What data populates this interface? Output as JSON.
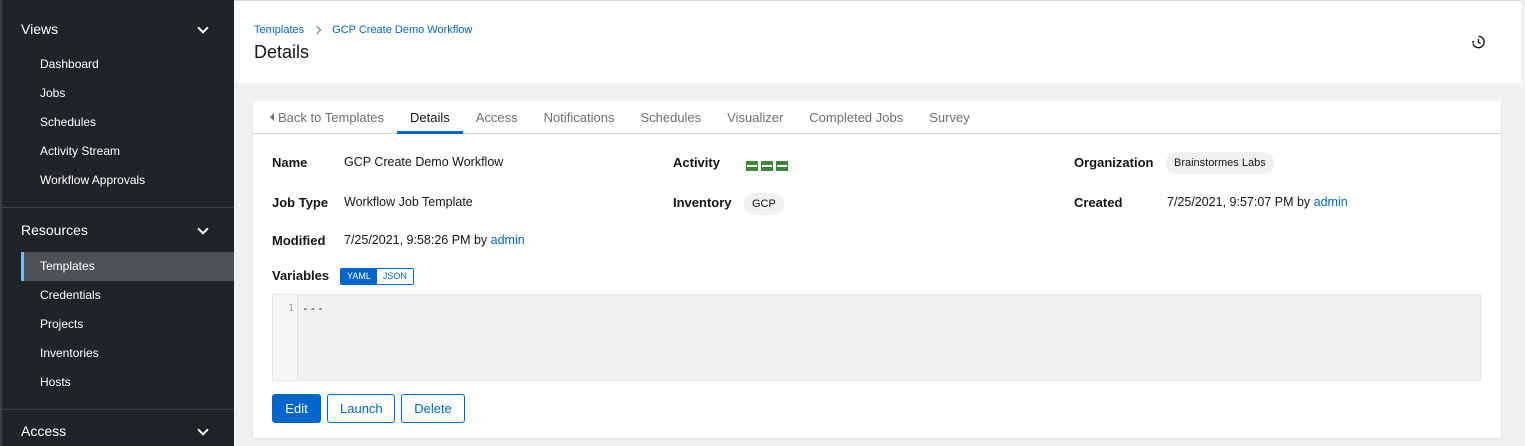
{
  "sidebar": {
    "sections": [
      {
        "title": "Views",
        "items": [
          "Dashboard",
          "Jobs",
          "Schedules",
          "Activity Stream",
          "Workflow Approvals"
        ]
      },
      {
        "title": "Resources",
        "items": [
          "Templates",
          "Credentials",
          "Projects",
          "Inventories",
          "Hosts"
        ]
      },
      {
        "title": "Access",
        "items": []
      }
    ],
    "active_item": "Templates"
  },
  "header": {
    "breadcrumb": {
      "root": "Templates",
      "current": "GCP Create Demo Workflow"
    },
    "title": "Details",
    "history_icon": "history-icon"
  },
  "tabs": {
    "back": "Back to Templates",
    "items": [
      "Details",
      "Access",
      "Notifications",
      "Schedules",
      "Visualizer",
      "Completed Jobs",
      "Survey"
    ],
    "active": "Details"
  },
  "details": {
    "name_label": "Name",
    "name_value": "GCP Create Demo Workflow",
    "activity_label": "Activity",
    "activity_count": 3,
    "organization_label": "Organization",
    "organization_value": "Brainstormes Labs",
    "job_type_label": "Job Type",
    "job_type_value": "Workflow Job Template",
    "inventory_label": "Inventory",
    "inventory_value": "GCP",
    "created_label": "Created",
    "created_value": "7/25/2021, 9:57:07 PM by",
    "created_by": "admin",
    "modified_label": "Modified",
    "modified_value": "7/25/2021, 9:58:26 PM by",
    "modified_by": "admin",
    "variables_label": "Variables",
    "toggle_yaml": "YAML",
    "toggle_json": "JSON",
    "code_line_number": "1",
    "code_text": "---"
  },
  "buttons": {
    "edit": "Edit",
    "launch": "Launch",
    "delete": "Delete"
  },
  "colors": {
    "accent": "#0066cc",
    "sidebar_bg": "#212427",
    "success": "#3e8635"
  }
}
